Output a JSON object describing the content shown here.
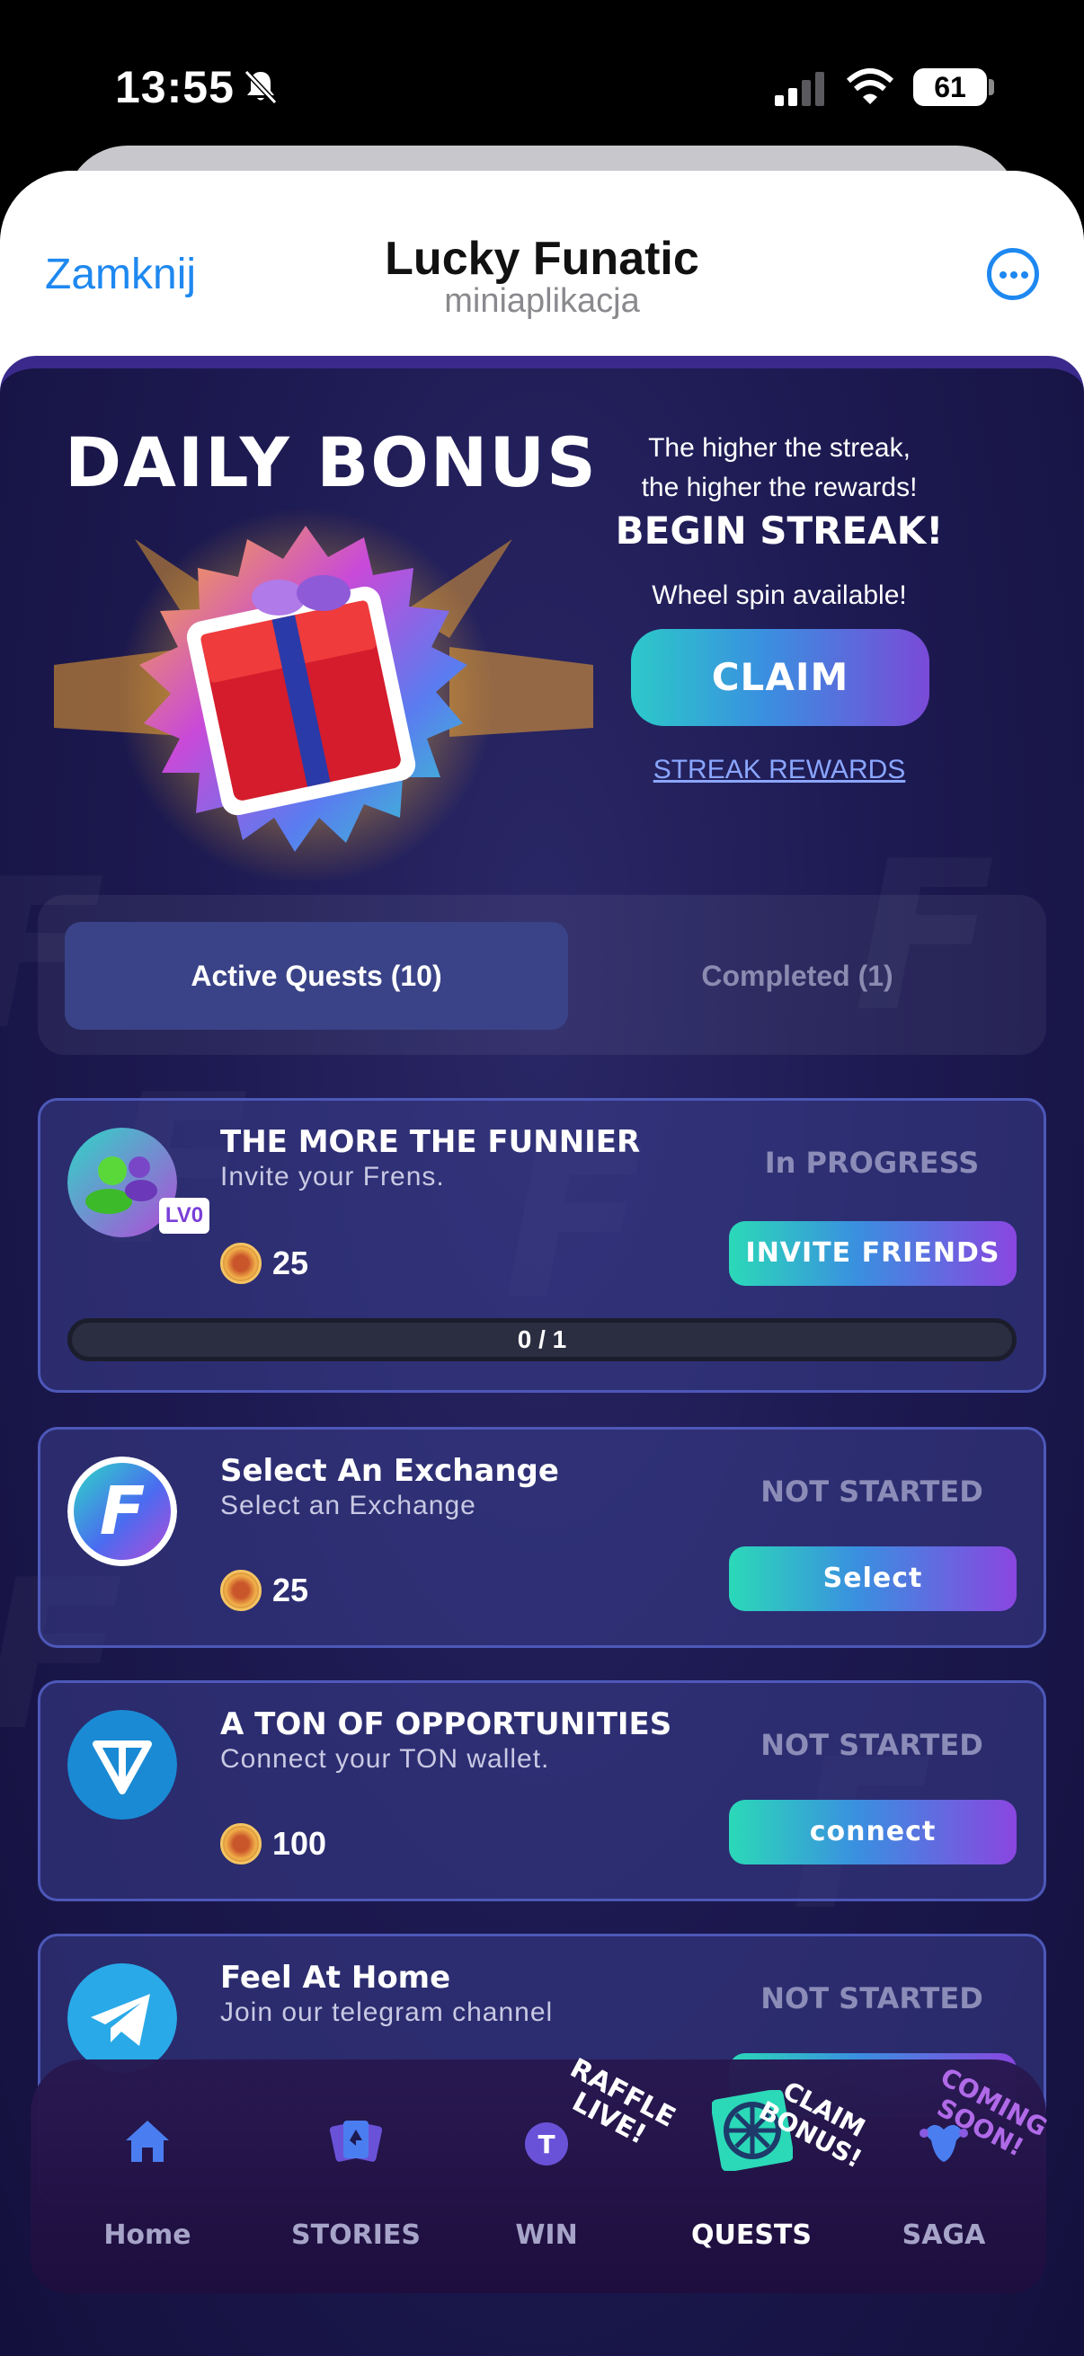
{
  "status_bar": {
    "time": "13:55",
    "battery": "61",
    "icons": [
      "bell-slash-icon",
      "cellular-signal-icon",
      "wifi-icon",
      "battery-icon"
    ]
  },
  "header": {
    "close_label": "Zamknij",
    "title": "Lucky Funatic",
    "subtitle": "miniaplikacja",
    "more_icon": "more-icon"
  },
  "daily_bonus": {
    "title": "DAILY BONUS",
    "streak_line1": "The higher the streak,",
    "streak_line2": "the higher the rewards!",
    "begin_streak": "BEGIN STREAK!",
    "wheel_spin": "Wheel spin available!",
    "claim_label": "CLAIM",
    "streak_rewards_label": "STREAK REWARDS",
    "gift_icon": "gift-icon"
  },
  "tabs": {
    "active": "Active Quests (10)",
    "completed": "Completed (1)"
  },
  "quests": [
    {
      "title": "THE MORE THE FUNNIER",
      "desc": "Invite your Frens.",
      "reward": "25",
      "status": "In PROGRESS",
      "button": "INVITE FRIENDS",
      "progress_text": "0 / 1",
      "progress": 0,
      "level_badge": "LV0",
      "icon": "friends-icon"
    },
    {
      "title": "Select An Exchange",
      "desc": "Select an Exchange",
      "reward": "25",
      "status": "NOT STARTED",
      "button": "Select",
      "icon": "exchange-logo-icon"
    },
    {
      "title": "A TON OF OPPORTUNITIES",
      "desc": "Connect your TON wallet.",
      "reward": "100",
      "status": "NOT STARTED",
      "button": "connect",
      "icon": "ton-icon"
    },
    {
      "title": "Feel At Home",
      "desc": "Join our telegram channel",
      "status": "NOT STARTED",
      "icon": "telegram-icon"
    }
  ],
  "nav": {
    "items": [
      {
        "label": "Home",
        "icon": "home-icon"
      },
      {
        "label": "STORIES",
        "icon": "cards-icon"
      },
      {
        "label": "WIN",
        "icon": "ton-coin-icon"
      },
      {
        "label": "QUESTS",
        "icon": "wheel-icon"
      },
      {
        "label": "SAGA",
        "icon": "jester-icon"
      }
    ],
    "active": "QUESTS",
    "stickers": {
      "win": "RAFFLE LIVE!",
      "quests": "CLAIM BONUS!",
      "saga": "COMING SOON!"
    }
  },
  "colors": {
    "accent_blue": "#1e88f0",
    "gradient_start": "#2bd9b8",
    "gradient_end": "#8a46e0",
    "bg": "#1d1a52"
  }
}
